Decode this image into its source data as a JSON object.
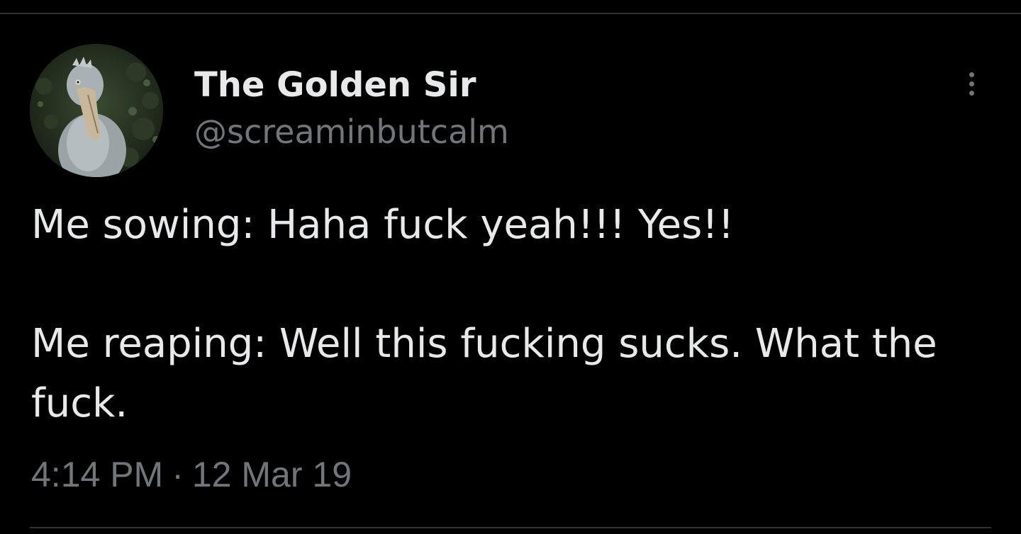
{
  "tweet": {
    "author": {
      "display_name": "The Golden Sir",
      "handle": "@screaminbutcalm",
      "avatar_subject": "shoebill-bird-avatar"
    },
    "text_lines": [
      "Me sowing: Haha fuck yeah!!! Yes!!",
      "Me reaping: Well this fucking sucks. What the fuck."
    ],
    "time": "4:14 PM",
    "separator": "·",
    "date": "12 Mar 19",
    "more_icon": "more-options-icon"
  },
  "colors": {
    "background": "#000000",
    "primary_text": "#e7e9ea",
    "secondary_text": "#71767b",
    "divider": "#2f3336"
  }
}
